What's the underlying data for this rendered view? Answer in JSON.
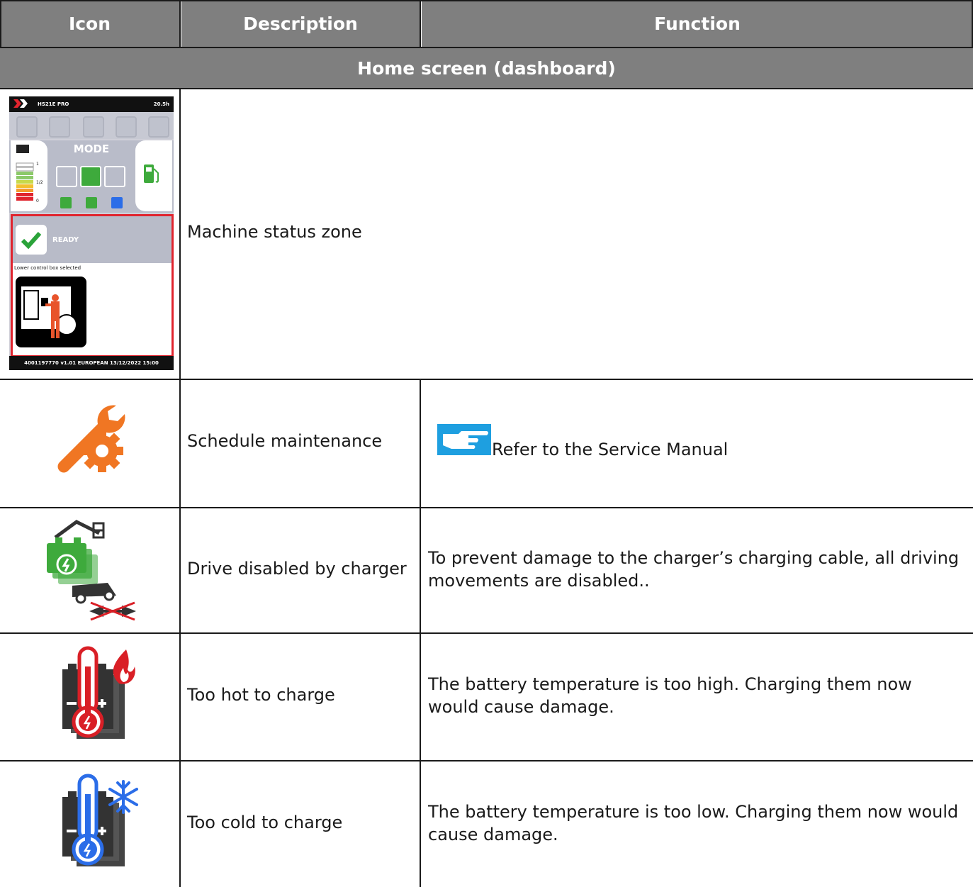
{
  "table": {
    "headers": {
      "icon": "Icon",
      "description": "Description",
      "function": "Function"
    },
    "section": "Home screen (dashboard)",
    "rows": [
      {
        "icon": "dashboard-screen-icon",
        "description": "Machine status zone",
        "function": ""
      },
      {
        "icon": "wrench-gear-icon",
        "description": "Schedule maintenance",
        "function": "Refer to the Service Manual"
      },
      {
        "icon": "drive-disabled-charger-icon",
        "description": "Drive disabled by charger",
        "function": "To prevent damage to the charger’s charging cable, all driving movements are disabled.."
      },
      {
        "icon": "battery-hot-icon",
        "description": "Too hot to charge",
        "function": "The battery temperature is too high. Charging them now would cause damage."
      },
      {
        "icon": "battery-cold-icon",
        "description": "Too cold to charge",
        "function": "The battery temperature is too low. Charging them now would cause damage."
      }
    ]
  },
  "dashboard": {
    "model": "HS21E PRO",
    "hours": "20.5h",
    "mode_label": "MODE",
    "status": "READY",
    "control_box": "Lower control box selected",
    "footer": "4001197770  v1.01  EUROPEAN  13/12/2022  15:00",
    "gauge_marks": [
      "1",
      "1/2",
      "0"
    ]
  },
  "colors": {
    "header_bg": "#7f7f7f",
    "accent_orange": "#f07623",
    "charger_green": "#3eaa3c",
    "hot_red": "#d91f26",
    "cold_blue": "#2b6de8",
    "hand_blue": "#1e9fe0"
  }
}
